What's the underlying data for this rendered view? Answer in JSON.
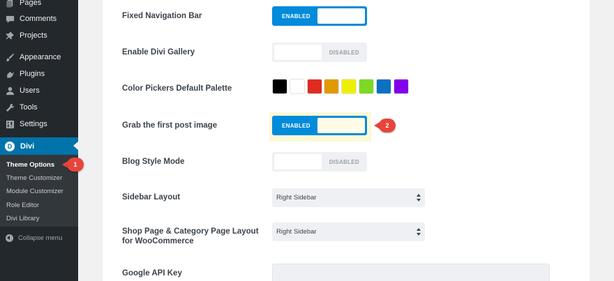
{
  "sidebar": {
    "items": [
      {
        "label": "Pages",
        "icon": "pages-icon"
      },
      {
        "label": "Comments",
        "icon": "comments-icon"
      },
      {
        "label": "Projects",
        "icon": "projects-icon"
      },
      {
        "label": "Appearance",
        "icon": "appearance-icon"
      },
      {
        "label": "Plugins",
        "icon": "plugins-icon"
      },
      {
        "label": "Users",
        "icon": "users-icon"
      },
      {
        "label": "Tools",
        "icon": "tools-icon"
      },
      {
        "label": "Settings",
        "icon": "settings-icon"
      }
    ],
    "active": {
      "label": "Divi",
      "icon": "divi-logo-icon",
      "logo_letter": "D"
    },
    "submenu": [
      {
        "label": "Theme Options",
        "current": true
      },
      {
        "label": "Theme Customizer"
      },
      {
        "label": "Module Customizer"
      },
      {
        "label": "Role Editor"
      },
      {
        "label": "Divi Library"
      }
    ],
    "collapse_label": "Collapse menu"
  },
  "callouts": {
    "first": "1",
    "second": "2"
  },
  "options": {
    "fixed_nav": {
      "label": "Fixed Navigation Bar",
      "state": "ENABLED"
    },
    "divi_gallery": {
      "label": "Enable Divi Gallery",
      "state": "DISABLED"
    },
    "color_palette": {
      "label": "Color Pickers Default Palette",
      "colors": [
        "#000000",
        "#ffffff",
        "#e02b20",
        "#e09900",
        "#edf000",
        "#7cda24",
        "#0c71c3",
        "#8300e9"
      ]
    },
    "first_post_image": {
      "label": "Grab the first post image",
      "state": "ENABLED"
    },
    "blog_style": {
      "label": "Blog Style Mode",
      "state": "DISABLED"
    },
    "sidebar_layout": {
      "label": "Sidebar Layout",
      "value": "Right Sidebar"
    },
    "shop_layout": {
      "label_line1": "Shop Page & Category Page Layout",
      "label_line2": "for WooCommerce",
      "value": "Right Sidebar"
    },
    "google_api": {
      "label": "Google API Key",
      "value": ""
    }
  },
  "colors": {
    "sidebar_bg": "#23282d",
    "accent": "#0073aa",
    "toggle_on": "#008bdb",
    "callout": "#e7453b",
    "highlight": "#fdf8d6"
  }
}
